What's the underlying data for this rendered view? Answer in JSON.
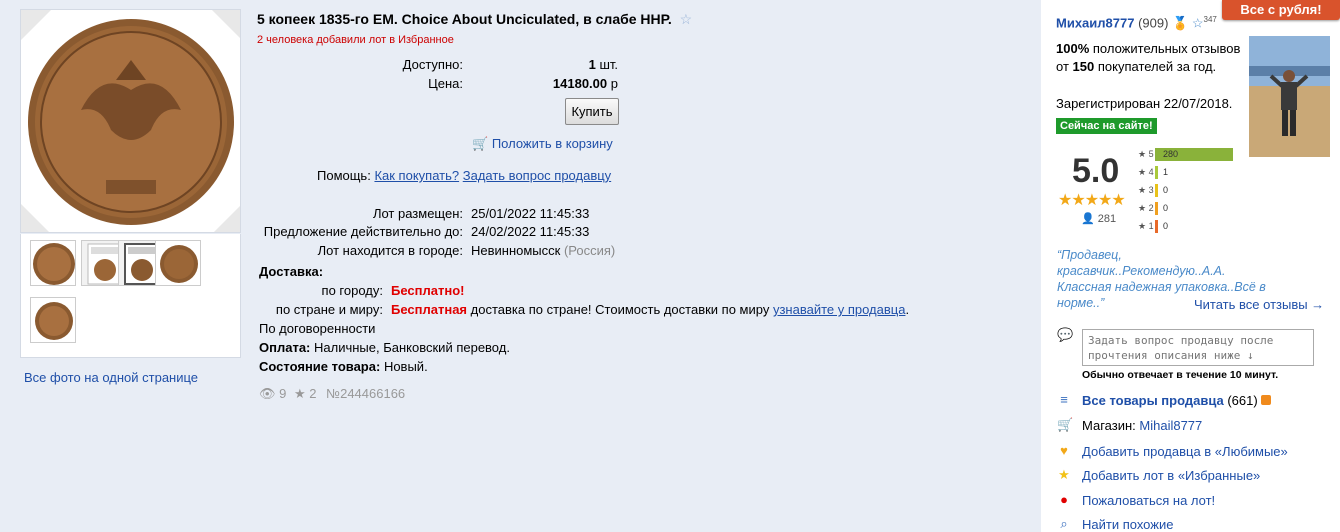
{
  "gallery": {
    "all_photos_link": "Все фото на одной странице"
  },
  "lot": {
    "title": "5 копеек 1835-го ЕМ. Choice About Unciculated, в слабе ННР.",
    "favorites_note": "2 человека добавили лот в Избранное",
    "available_label": "Доступно:",
    "available_value": "1",
    "available_unit": "шт.",
    "price_label": "Цена:",
    "price_value": "14180.00",
    "price_currency": "р",
    "buy_label": "Купить",
    "cart_link": "Положить в корзину",
    "help_label": "Помощь:",
    "help_how": "Как покупать?",
    "help_ask": "Задать вопрос продавцу",
    "posted_label": "Лот размещен:",
    "posted_value": "25/01/2022 11:45:33",
    "valid_label": "Предложение действительно до:",
    "valid_value": "24/02/2022 11:45:33",
    "city_label": "Лот находится в городе:",
    "city_value": "Невинномысск",
    "city_country": "(Россия)",
    "delivery_label": "Доставка:",
    "delivery_city_label": "по городу:",
    "delivery_city_value": "Бесплатно!",
    "delivery_country_label": "по стране и миру:",
    "delivery_country_free": "Бесплатная",
    "delivery_country_text": "доставка по стране! Стоимость доставки по миру",
    "delivery_country_link": "узнавайте у продавца",
    "delivery_agreement": "По договоренности",
    "payment_label": "Оплата:",
    "payment_value": "Наличные, Банковский перевод.",
    "condition_label": "Состояние товара:",
    "condition_value": "Новый.",
    "views": "9",
    "stars": "2",
    "lot_number": "№244466166"
  },
  "seller": {
    "badge": "Все с рубля!",
    "name": "Михаил8777",
    "count": "(909)",
    "star_count": "347",
    "positive_percent": "100%",
    "positive_text1": "положительных",
    "positive_text2": "отзывов от",
    "positive_buyers": "150",
    "positive_text3": "покупателей",
    "positive_text4": "за год.",
    "registered": "Зарегистрирован 22/07/2018.",
    "online": "Сейчас на сайте!",
    "rating": "5.0",
    "reviews_count": "281",
    "breakdown": [
      {
        "stars": "5",
        "count": "280",
        "fraction": 1.0,
        "color": "#8ab23a"
      },
      {
        "stars": "4",
        "count": "1",
        "fraction": 0.0036,
        "color": "#a9c93a"
      },
      {
        "stars": "3",
        "count": "0",
        "fraction": 0,
        "color": "#e8c21a"
      },
      {
        "stars": "2",
        "count": "0",
        "fraction": 0,
        "color": "#f0a020"
      },
      {
        "stars": "1",
        "count": "0",
        "fraction": 0,
        "color": "#e86a2a"
      }
    ],
    "quote": "“Продавец, красавчик..Рекомендую..А.А. Классная надежная упаковка..Всё в норме..”",
    "read_all": "Читать все отзывы →",
    "ask_placeholder": "Задать вопрос продавцу после прочтения описания ниже ↓",
    "reply_note": "Обычно отвечает в течение 10 минут.",
    "all_items_label": "Все товары продавца",
    "all_items_count": "(661)",
    "shop_label": "Магазин:",
    "shop_link": "Mihail8777",
    "add_seller_fav": "Добавить продавца в «Любимые»",
    "add_lot_fav": "Добавить лот в «Избранные»",
    "complain": "Пожаловаться на лот!",
    "find_similar": "Найти похожие"
  },
  "colors": {
    "link": "#1f4fa8",
    "price_free": "#e00000",
    "online": "#1e9a2b",
    "badge": "#d9532c"
  }
}
